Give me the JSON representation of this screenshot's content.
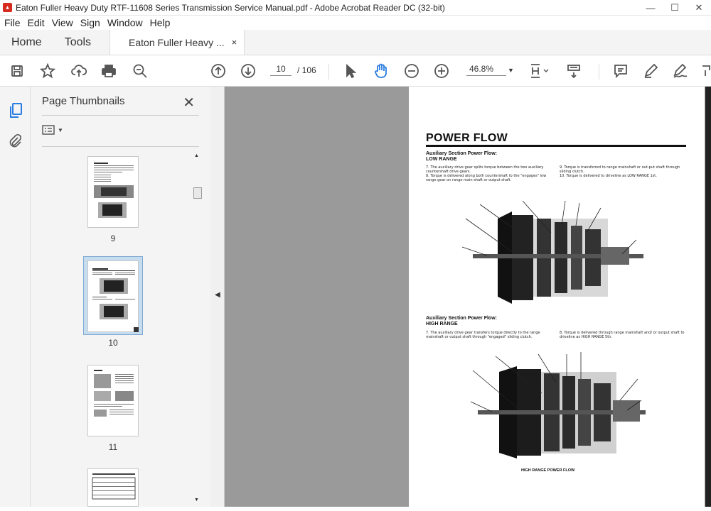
{
  "window": {
    "title": "Eaton Fuller Heavy Duty RTF-11608 Series Transmission Service Manual.pdf - Adobe Acrobat Reader DC (32-bit)",
    "minimize": "—",
    "maximize": "☐",
    "close": "✕"
  },
  "menu": [
    "File",
    "Edit",
    "View",
    "Sign",
    "Window",
    "Help"
  ],
  "tabs": {
    "home": "Home",
    "tools": "Tools",
    "document": "Eaton Fuller Heavy ...",
    "document_close": "×"
  },
  "toolbar": {
    "current_page": "10",
    "total_pages": "/ 106",
    "zoom": "46.8%"
  },
  "thumbnails": {
    "title": "Page Thumbnails",
    "close": "✕",
    "pages": [
      "9",
      "10",
      "11"
    ]
  },
  "document": {
    "heading": "POWER FLOW",
    "section1_title": "Auxiliary  Section  Power  Flow:",
    "section1_subtitle": "LOW  RANGE",
    "section1_left": "7.  The auxiliary drive gear splits torque between the two auxiliary countershaft drive gears.\n8.  Torque is delivered along both countershaft to the \"engages\" low range gear on range main-shaft or output shaft.",
    "section1_right": "9.  Torque is transferred to range mainshaft or out-put shaft through sliding clutch.\n10.  Torque is delivered to driveline as LOW RANGE 1st.",
    "section2_title": "Auxiliary  Section  Power  Flow:",
    "section2_subtitle": "HIGH  RANGE",
    "section2_left": "7.  The auxiliary drive gear transfers torque directly to the range mainshaft or output shaft through \"engaged\" sliding clutch.",
    "section2_right": "8.  Torque is delivered through range mainshaft and/ or output shaft to driveline as HIGH RANGE 5th.",
    "caption": "HIGH RANGE POWER FLOW"
  },
  "colors": {
    "accent": "#d62b1f",
    "selection": "#c6dcef",
    "doc_background": "#9a9a9a"
  }
}
